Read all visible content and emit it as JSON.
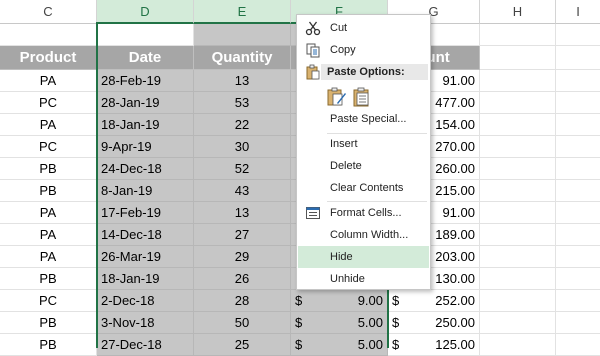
{
  "columns": [
    "C",
    "D",
    "E",
    "F",
    "G",
    "H",
    "I"
  ],
  "table": {
    "headers": {
      "product": "Product",
      "date": "Date",
      "quantity": "Quantity",
      "amount": "ount"
    },
    "currency_symbol": "$",
    "rows": [
      {
        "product": "PA",
        "date": "28-Feb-19",
        "quantity": "13",
        "price": "",
        "amount": "91.00"
      },
      {
        "product": "PC",
        "date": "28-Jan-19",
        "quantity": "53",
        "price": "",
        "amount": "477.00"
      },
      {
        "product": "PA",
        "date": "18-Jan-19",
        "quantity": "22",
        "price": "",
        "amount": "154.00"
      },
      {
        "product": "PC",
        "date": "9-Apr-19",
        "quantity": "30",
        "price": "",
        "amount": "270.00"
      },
      {
        "product": "PB",
        "date": "24-Dec-18",
        "quantity": "52",
        "price": "",
        "amount": "260.00"
      },
      {
        "product": "PB",
        "date": "8-Jan-19",
        "quantity": "43",
        "price": "",
        "amount": "215.00"
      },
      {
        "product": "PA",
        "date": "17-Feb-19",
        "quantity": "13",
        "price": "",
        "amount": "91.00"
      },
      {
        "product": "PA",
        "date": "14-Dec-18",
        "quantity": "27",
        "price": "",
        "amount": "189.00"
      },
      {
        "product": "PA",
        "date": "26-Mar-19",
        "quantity": "29",
        "price": "",
        "amount": "203.00"
      },
      {
        "product": "PB",
        "date": "18-Jan-19",
        "quantity": "26",
        "price": "",
        "amount": "130.00"
      },
      {
        "product": "PC",
        "date": "2-Dec-18",
        "quantity": "28",
        "price": "9.00",
        "amount": "252.00"
      },
      {
        "product": "PB",
        "date": "3-Nov-18",
        "quantity": "50",
        "price": "5.00",
        "amount": "250.00"
      },
      {
        "product": "PB",
        "date": "27-Dec-18",
        "quantity": "25",
        "price": "5.00",
        "amount": "125.00"
      }
    ]
  },
  "context_menu": {
    "cut": {
      "label": "Cut",
      "icon": "scissors-icon"
    },
    "copy": {
      "label": "Copy",
      "icon": "copy-icon"
    },
    "paste_options": {
      "label": "Paste Options:",
      "icons": [
        "paste-formatting-icon",
        "paste-icon"
      ]
    },
    "paste_special": {
      "label": "Paste Special..."
    },
    "insert": {
      "label": "Insert"
    },
    "delete": {
      "label": "Delete"
    },
    "clear_contents": {
      "label": "Clear Contents"
    },
    "format_cells": {
      "label": "Format Cells...",
      "icon": "format-cells-icon"
    },
    "column_width": {
      "label": "Column Width..."
    },
    "hide": {
      "label": "Hide",
      "highlighted": true
    },
    "unhide": {
      "label": "Unhide"
    }
  },
  "colors": {
    "header_fill": "#a6a6a6",
    "selected_fill": "#c6c6c6",
    "selection_accent": "#217346",
    "menu_highlight": "#d3ebd9"
  }
}
